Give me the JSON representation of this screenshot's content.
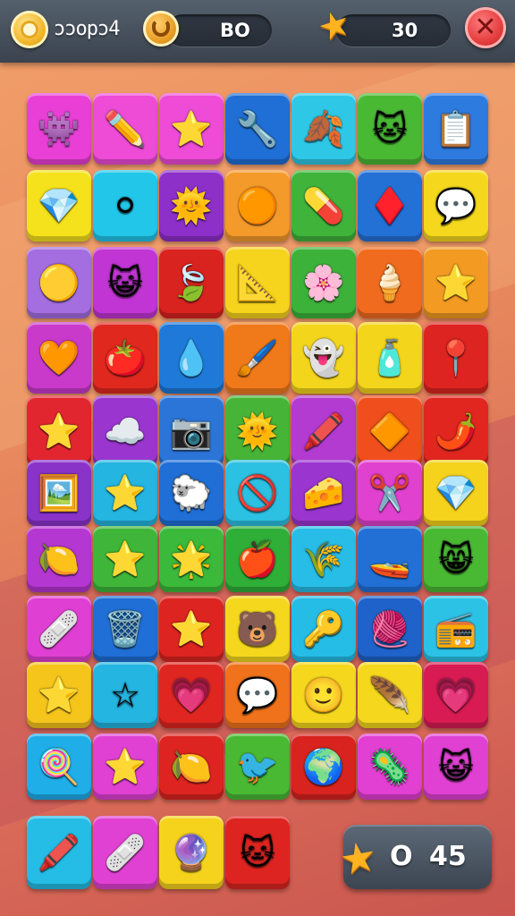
{
  "header": {
    "title": "ɔɔopɔ4",
    "resource_a_value": "BO",
    "resource_b_value": "30",
    "close_symbol": "✕",
    "resource_a_icon": "gold-coin-icon",
    "resource_b_icon": "star-icon",
    "title_icon": "coin-badge-icon",
    "close_icon": "close-icon"
  },
  "footer": {
    "score_left": "O",
    "score_right": "45",
    "score_icon": "star-icon"
  },
  "board": {
    "columns": 7,
    "rows": [
      [
        {
          "name": "blue-monster-icon",
          "glyph": "👾",
          "color": "#e93fd6"
        },
        {
          "name": "pencil-icon",
          "glyph": "✏️",
          "color": "#ee4bd6"
        },
        {
          "name": "smiling-star-icon",
          "glyph": "⭐",
          "color": "#ee4bd6"
        },
        {
          "name": "grabber-tool-icon",
          "glyph": "🔧",
          "color": "#1f6fd6"
        },
        {
          "name": "leaf-gem-icon",
          "glyph": "🍂",
          "color": "#2ec8e6"
        },
        {
          "name": "cat-face-icon",
          "glyph": "🐱",
          "color": "#49b934"
        },
        {
          "name": "clipboard-icon",
          "glyph": "📋",
          "color": "#2e7be0"
        }
      ],
      [
        {
          "name": "blue-crystal-icon",
          "glyph": "💎",
          "color": "#f5e21c"
        },
        {
          "name": "white-ball-icon",
          "glyph": "⚪",
          "color": "#22c6e9"
        },
        {
          "name": "sun-flower-icon",
          "glyph": "🌞",
          "color": "#8d2fc9"
        },
        {
          "name": "orange-blob-icon",
          "glyph": "🟠",
          "color": "#f49a2b"
        },
        {
          "name": "orange-capsule-icon",
          "glyph": "💊",
          "color": "#3fb33a"
        },
        {
          "name": "red-gem-icon",
          "glyph": "♦️",
          "color": "#2471d6"
        },
        {
          "name": "speech-ring-icon",
          "glyph": "💬",
          "color": "#f5d81d"
        }
      ],
      [
        {
          "name": "yellow-blob-icon",
          "glyph": "🟡",
          "color": "#a46ee0"
        },
        {
          "name": "blue-cat-icon",
          "glyph": "😺",
          "color": "#c035d3"
        },
        {
          "name": "green-leaf-icon",
          "glyph": "🍃",
          "color": "#d8231f"
        },
        {
          "name": "compass-tool-icon",
          "glyph": "📐",
          "color": "#f6d31c"
        },
        {
          "name": "pink-flower-icon",
          "glyph": "🌸",
          "color": "#3cb23a"
        },
        {
          "name": "ice-cream-icon",
          "glyph": "🍦",
          "color": "#f06b1d"
        },
        {
          "name": "teal-starfish-icon",
          "glyph": "⭐",
          "color": "#f39a22"
        }
      ],
      [
        {
          "name": "heart-icon",
          "glyph": "🧡",
          "color": "#c93acb"
        },
        {
          "name": "tomato-icon",
          "glyph": "🍅",
          "color": "#e0281f"
        },
        {
          "name": "water-drop-icon",
          "glyph": "💧",
          "color": "#1e79d8"
        },
        {
          "name": "paint-brush-icon",
          "glyph": "🖌️",
          "color": "#f07a1a"
        },
        {
          "name": "pink-ghost-icon",
          "glyph": "👻",
          "color": "#f3d51c"
        },
        {
          "name": "red-jar-icon",
          "glyph": "🧴",
          "color": "#f3d51c"
        },
        {
          "name": "map-pin-icon",
          "glyph": "📍",
          "color": "#dd2420"
        }
      ],
      [
        {
          "name": "smiling-star-icon",
          "glyph": "⭐",
          "color": "#e2262f"
        },
        {
          "name": "pink-cloud-icon",
          "glyph": "☁️",
          "color": "#9a36cf"
        },
        {
          "name": "camera-icon",
          "glyph": "📷",
          "color": "#2b75d8"
        },
        {
          "name": "sun-gear-icon",
          "glyph": "🌞",
          "color": "#46b537"
        },
        {
          "name": "blue-crayon-icon",
          "glyph": "🖍️",
          "color": "#b33bd1"
        },
        {
          "name": "yellow-gem-icon",
          "glyph": "🔶",
          "color": "#f04e1d"
        },
        {
          "name": "orange-chili-icon",
          "glyph": "🌶️",
          "color": "#e0261f"
        }
      ],
      [
        {
          "name": "picture-card-icon",
          "glyph": "🖼️",
          "color": "#8a33c9"
        },
        {
          "name": "cookie-star-icon",
          "glyph": "⭐",
          "color": "#24b5e0"
        },
        {
          "name": "pink-sheep-icon",
          "glyph": "🐑",
          "color": "#1f6fd6"
        },
        {
          "name": "no-sign-icon",
          "glyph": "🚫",
          "color": "#2cc0e3"
        },
        {
          "name": "cheese-box-icon",
          "glyph": "🧀",
          "color": "#9a35cf"
        },
        {
          "name": "scissors-icon",
          "glyph": "✂️",
          "color": "#e141cf"
        },
        {
          "name": "blue-crystal-icon",
          "glyph": "💎",
          "color": "#f5d31c"
        }
      ],
      [
        {
          "name": "yellow-leaf-icon",
          "glyph": "🍋",
          "color": "#b537d1"
        },
        {
          "name": "smiling-star-icon",
          "glyph": "⭐",
          "color": "#3fb63a"
        },
        {
          "name": "yellow-star-icon",
          "glyph": "🌟",
          "color": "#3bb93a"
        },
        {
          "name": "apple-icon",
          "glyph": "🍎",
          "color": "#2fae38"
        },
        {
          "name": "wheat-icon",
          "glyph": "🌾",
          "color": "#27bde6"
        },
        {
          "name": "submarine-icon",
          "glyph": "🚤",
          "color": "#2270d6"
        },
        {
          "name": "cat-star-icon",
          "glyph": "😸",
          "color": "#49b934"
        }
      ],
      [
        {
          "name": "pink-eraser-icon",
          "glyph": "🩹",
          "color": "#e03fd3"
        },
        {
          "name": "trash-can-icon",
          "glyph": "🗑️",
          "color": "#1f6fd6"
        },
        {
          "name": "green-star-icon",
          "glyph": "⭐",
          "color": "#dd2420"
        },
        {
          "name": "bear-face-icon",
          "glyph": "🐻",
          "color": "#f5d81d"
        },
        {
          "name": "yellow-key-icon",
          "glyph": "🔑",
          "color": "#25bde6"
        },
        {
          "name": "wire-ball-icon",
          "glyph": "🧶",
          "color": "#1f62c9"
        },
        {
          "name": "radio-icon",
          "glyph": "📻",
          "color": "#2bc2e6"
        }
      ],
      [
        {
          "name": "blue-star-face-icon",
          "glyph": "⭐",
          "color": "#f5c51c"
        },
        {
          "name": "outline-star-icon",
          "glyph": "☆",
          "color": "#24b5e0"
        },
        {
          "name": "pink-heart-icon",
          "glyph": "💗",
          "color": "#df2620"
        },
        {
          "name": "blue-bubble-icon",
          "glyph": "💬",
          "color": "#f0721b"
        },
        {
          "name": "orange-face-icon",
          "glyph": "🙂",
          "color": "#f5d81d"
        },
        {
          "name": "blue-feather-icon",
          "glyph": "🪶",
          "color": "#f5d81d"
        },
        {
          "name": "pink-drop-icon",
          "glyph": "💗",
          "color": "#d81b52"
        }
      ],
      [
        {
          "name": "lollipop-icon",
          "glyph": "🍭",
          "color": "#1faee8"
        },
        {
          "name": "smiling-star-icon",
          "glyph": "⭐",
          "color": "#e141d3"
        },
        {
          "name": "lemon-face-icon",
          "glyph": "🍋",
          "color": "#dd2420"
        },
        {
          "name": "grey-bird-icon",
          "glyph": "🐦",
          "color": "#49b934"
        },
        {
          "name": "green-planet-icon",
          "glyph": "🌍",
          "color": "#d8231f"
        },
        {
          "name": "green-splat-icon",
          "glyph": "🦠",
          "color": "#e23fd3"
        },
        {
          "name": "blue-cat-icon",
          "glyph": "😺",
          "color": "#e141d3"
        }
      ],
      [
        {
          "name": "crayon-icon",
          "glyph": "🖍️",
          "color": "#25bde6"
        },
        {
          "name": "bandage-icon",
          "glyph": "🩹",
          "color": "#e141d3"
        },
        {
          "name": "pink-ball-icon",
          "glyph": "🔮",
          "color": "#f5d31c"
        },
        {
          "name": "fox-face-icon",
          "glyph": "🐱",
          "color": "#dd2420"
        }
      ]
    ]
  }
}
